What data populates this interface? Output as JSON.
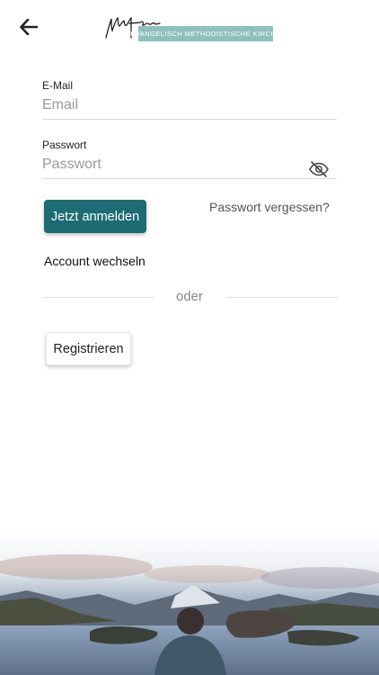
{
  "header": {
    "back_icon": "arrow-left-icon",
    "logo": {
      "script_text": "netzingen",
      "banner_text": "EVANGELISCH METHODISTISCHE KIRCHE",
      "banner_color": "#8fc0bd"
    }
  },
  "form": {
    "email": {
      "label": "E-Mail",
      "placeholder": "Email",
      "value": ""
    },
    "password": {
      "label": "Passwort",
      "placeholder": "Passwort",
      "value": "",
      "toggle_icon": "eye-slash-icon"
    },
    "login_label": "Jetzt anmelden",
    "forgot_label": "Passwort vergessen?",
    "switch_account_label": "Account wechseln",
    "divider_text": "oder",
    "register_label": "Registrieren"
  },
  "colors": {
    "accent": "#1d6b73",
    "text": "#222222",
    "muted": "#9a9a9a"
  },
  "background_image": "mountain-lake-landscape"
}
